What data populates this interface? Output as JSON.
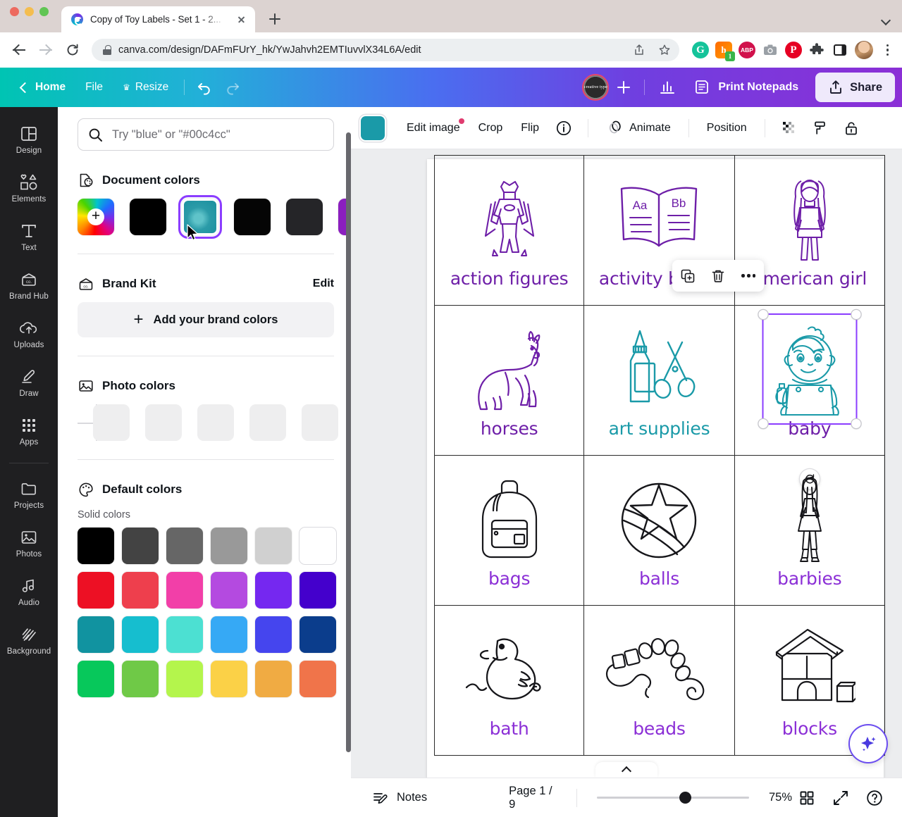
{
  "browser": {
    "tab": {
      "title": "Copy of Toy Labels - Set 1 - 2...",
      "favicon": "canva-icon",
      "close": "close-icon"
    },
    "new_tab_label": "new-tab-icon",
    "url": "canva.com/design/DAFmFUrY_hk/YwJahvh2EMTIuvvlX34L6A/edit",
    "nav": {
      "back": "back-icon",
      "forward": "forward-icon",
      "reload": "reload-icon"
    },
    "url_icons": [
      "share-icon",
      "bookmark-star-icon"
    ],
    "extensions": [
      {
        "name": "grammarly-extension",
        "glyph": "G"
      },
      {
        "name": "honey-extension",
        "glyph": "h",
        "badge": "1"
      },
      {
        "name": "adblock-plus-extension",
        "glyph": "ABP"
      },
      {
        "name": "screenshot-extension",
        "glyph": ""
      },
      {
        "name": "pinterest-extension",
        "glyph": "P"
      },
      {
        "name": "extensions-puzzle-icon",
        "glyph": ""
      },
      {
        "name": "side-panel-icon",
        "glyph": ""
      }
    ],
    "profile": "profile-avatar",
    "menu": "chrome-menu-icon"
  },
  "canva_header": {
    "back_label": "Home",
    "file_label": "File",
    "resize_label": "Resize",
    "undo": "undo-icon",
    "redo": "redo-icon",
    "team_avatar_text": "creative type",
    "add_member": "add-member-icon",
    "insights": "insights-icon",
    "print_label": "Print Notepads",
    "share_label": "Share"
  },
  "rail": {
    "items": [
      {
        "label": "Design",
        "icon": "design-icon"
      },
      {
        "label": "Elements",
        "icon": "elements-icon"
      },
      {
        "label": "Text",
        "icon": "text-icon"
      },
      {
        "label": "Brand Hub",
        "icon": "brand-hub-icon"
      },
      {
        "label": "Uploads",
        "icon": "uploads-icon"
      },
      {
        "label": "Draw",
        "icon": "draw-icon"
      },
      {
        "label": "Apps",
        "icon": "apps-icon"
      }
    ],
    "items2": [
      {
        "label": "Projects",
        "icon": "projects-icon"
      },
      {
        "label": "Photos",
        "icon": "photos-icon"
      },
      {
        "label": "Audio",
        "icon": "audio-icon"
      },
      {
        "label": "Background",
        "icon": "background-icon"
      }
    ]
  },
  "panel": {
    "search_placeholder": "Try \"blue\" or \"#00c4cc\"",
    "search_icon": "search-icon",
    "document_colors": {
      "title": "Document colors",
      "icon": "document-colors-icon",
      "add_label": "+",
      "swatches": [
        {
          "name": "custom-color-picker",
          "color": "rainbow"
        },
        {
          "name": "swatch-black",
          "color": "#000000"
        },
        {
          "name": "swatch-teal-image",
          "color": "#1a9aa8",
          "selected": true
        },
        {
          "name": "swatch-black-2",
          "color": "#050505"
        },
        {
          "name": "swatch-dark-gray",
          "color": "#252528"
        },
        {
          "name": "swatch-purple",
          "color": "#8b1fbf"
        }
      ]
    },
    "brand_kit": {
      "title": "Brand Kit",
      "icon": "brand-kit-icon",
      "edit_label": "Edit",
      "add_label": "Add your brand colors"
    },
    "photo_colors": {
      "title": "Photo colors",
      "icon": "photo-colors-icon",
      "swatches": [
        "#eeeeef",
        "#eeeeef",
        "#eeeeef",
        "#eeeeef",
        "#eeeeef"
      ]
    },
    "default_colors": {
      "title": "Default colors",
      "icon": "palette-icon",
      "solid_label": "Solid colors",
      "swatches": [
        "#000000",
        "#434343",
        "#666666",
        "#999999",
        "#d0d0d0",
        "#ffffff",
        "#ed1024",
        "#ee3f4d",
        "#f23fa8",
        "#b44ae0",
        "#7528f0",
        "#4400cc",
        "#1193a0",
        "#16becf",
        "#4ce0d2",
        "#36a9f5",
        "#4545ee",
        "#0b3d8c",
        "#07c85b",
        "#6fc947",
        "#b4f54c",
        "#fbd147",
        "#f0ab43",
        "#f0744a"
      ]
    }
  },
  "edit_toolbar": {
    "color_chip": "#1a9aa8",
    "edit_image_label": "Edit image",
    "crop_label": "Crop",
    "flip_label": "Flip",
    "info_icon": "info-icon",
    "animate_label": "Animate",
    "animate_icon": "animate-icon",
    "position_label": "Position",
    "transparency_icon": "transparency-icon",
    "copy_style_icon": "copy-style-icon",
    "lock_icon": "lock-icon"
  },
  "canvas": {
    "labels": [
      {
        "text": "action figures",
        "art": "superhero-icon",
        "color": "#6e1fa8"
      },
      {
        "text": "activity books",
        "art": "open-book-icon",
        "color": "#6e1fa8"
      },
      {
        "text": "american girl",
        "art": "girl-doll-icon",
        "color": "#6e1fa8",
        "occluded": true
      },
      {
        "text": "horses",
        "art": "horse-icon",
        "color": "#6e1fa8"
      },
      {
        "text": "art supplies",
        "art": "glue-scissors-icon",
        "color": "#1a9aa8"
      },
      {
        "text": "baby",
        "art": "baby-doll-icon",
        "color": "#6e1fa8",
        "selected": true
      },
      {
        "text": "bags",
        "art": "backpack-icon",
        "color": "#8b2fd6"
      },
      {
        "text": "balls",
        "art": "ball-icon",
        "color": "#8b2fd6"
      },
      {
        "text": "barbies",
        "art": "barbie-doll-icon",
        "color": "#8b2fd6"
      },
      {
        "text": "bath",
        "art": "rubber-duck-icon",
        "color": "#8b2fd6"
      },
      {
        "text": "beads",
        "art": "beads-icon",
        "color": "#8b2fd6"
      },
      {
        "text": "blocks",
        "art": "blocks-icon",
        "color": "#8b2fd6"
      }
    ],
    "float_toolbar": {
      "duplicate": "duplicate-icon",
      "delete": "trash-icon",
      "more": "more-options-icon"
    },
    "selection": {
      "rotate": "rotate-icon",
      "handles": 4
    },
    "ai_button": "magic-studio-sparkle-icon",
    "collapse": "collapse-panel-caret-icon"
  },
  "status_bar": {
    "notes_label": "Notes",
    "notes_icon": "notes-icon",
    "page_label": "Page 1 / 9",
    "zoom_value": "75%",
    "grid_view_icon": "grid-view-icon",
    "fullscreen_icon": "fullscreen-icon",
    "help_icon": "help-icon"
  }
}
